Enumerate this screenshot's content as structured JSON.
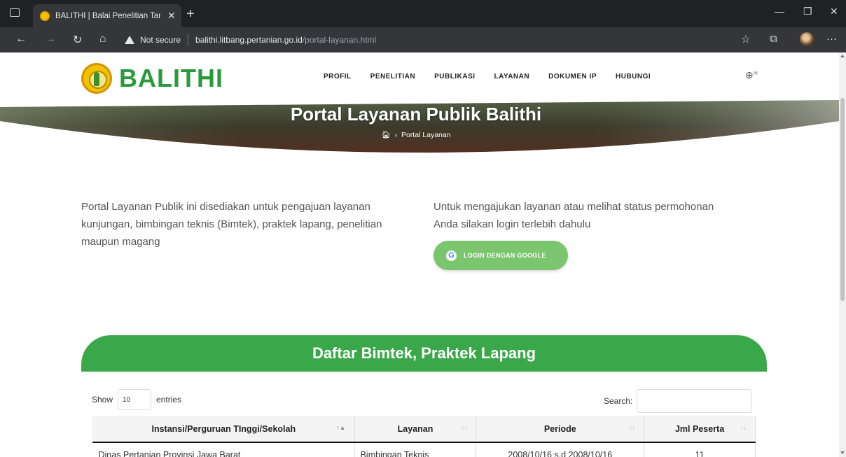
{
  "browser": {
    "tab_title": "BALITHI | Balai Penelitian Tanama",
    "security_label": "Not secure",
    "url_host": "balithi.litbang.pertanian.go.id",
    "url_path": "/portal-layanan.html"
  },
  "site": {
    "logo_text": "BALITHI",
    "menu": [
      "PROFIL",
      "PENELITIAN",
      "PUBLIKASI",
      "LAYANAN",
      "DOKUMEN IP",
      "HUBUNGI"
    ],
    "lang": "IN"
  },
  "hero": {
    "title": "Portal Layanan Publik Balithi",
    "breadcrumb_current": "Portal Layanan"
  },
  "intro": {
    "left_text": "Portal Layanan Publik ini disediakan untuk pengajuan layanan kunjungan, bimbingan teknis (Bimtek), praktek lapang, penelitian maupun magang",
    "right_text": "Untuk mengajukan layanan atau melihat status permohonan Anda silakan login terlebih dahulu",
    "login_button": "LOGIN DENGAN GOOGLE"
  },
  "table_section": {
    "heading": "Daftar Bimtek, Praktek Lapang",
    "show_label": "Show",
    "entries_value": "10",
    "entries_label": "entries",
    "search_label": "Search:",
    "columns": [
      "Instansi/Perguruan TInggi/Sekolah",
      "Layanan",
      "Periode",
      "Jml Peserta"
    ],
    "rows": [
      [
        "Dinas Pertanian Provinsi Jawa Barat",
        "Bimbingan Teknis",
        "2008/10/16 s.d 2008/10/16",
        "11"
      ]
    ]
  },
  "colors": {
    "brand_green": "#3aa84a",
    "button_green": "#7bc56e"
  }
}
